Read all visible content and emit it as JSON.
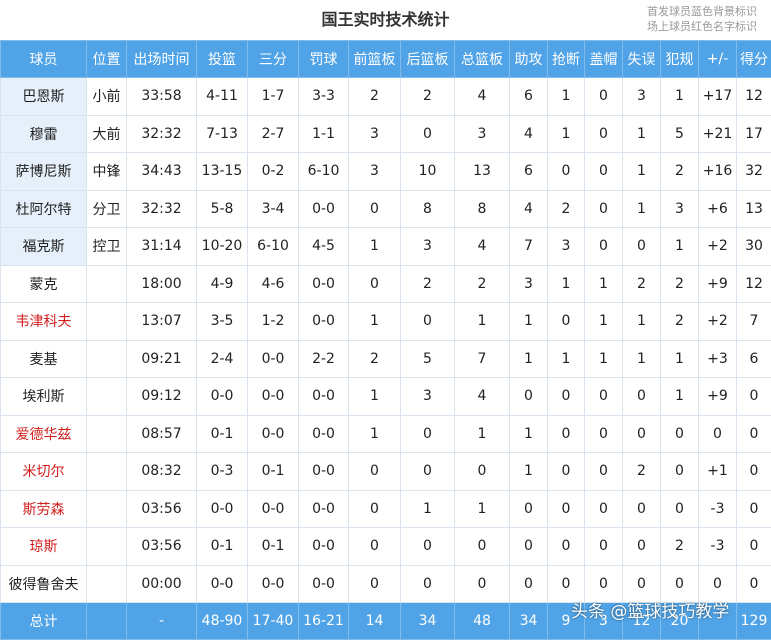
{
  "title": "国王实时技术统计",
  "legend": [
    "首发球员蓝色背景标识",
    "场上球员红色名字标识"
  ],
  "headers": [
    "球员",
    "位置",
    "出场时间",
    "投篮",
    "三分",
    "罚球",
    "前篮板",
    "后篮板",
    "总篮板",
    "助攻",
    "抢断",
    "盖帽",
    "失误",
    "犯规",
    "+/-",
    "得分"
  ],
  "rows": [
    {
      "name": "巴恩斯",
      "pos": "小前",
      "min": "33:58",
      "fg": "4-11",
      "tp": "1-7",
      "ft": "3-3",
      "oreb": "2",
      "dreb": "2",
      "reb": "4",
      "ast": "6",
      "stl": "1",
      "blk": "0",
      "tov": "3",
      "pf": "1",
      "pm": "+17",
      "pts": "12",
      "starter": true,
      "oncourt": false
    },
    {
      "name": "穆雷",
      "pos": "大前",
      "min": "32:32",
      "fg": "7-13",
      "tp": "2-7",
      "ft": "1-1",
      "oreb": "3",
      "dreb": "0",
      "reb": "3",
      "ast": "4",
      "stl": "1",
      "blk": "0",
      "tov": "1",
      "pf": "5",
      "pm": "+21",
      "pts": "17",
      "starter": true,
      "oncourt": false
    },
    {
      "name": "萨博尼斯",
      "pos": "中锋",
      "min": "34:43",
      "fg": "13-15",
      "tp": "0-2",
      "ft": "6-10",
      "oreb": "3",
      "dreb": "10",
      "reb": "13",
      "ast": "6",
      "stl": "0",
      "blk": "0",
      "tov": "1",
      "pf": "2",
      "pm": "+16",
      "pts": "32",
      "starter": true,
      "oncourt": false
    },
    {
      "name": "杜阿尔特",
      "pos": "分卫",
      "min": "32:32",
      "fg": "5-8",
      "tp": "3-4",
      "ft": "0-0",
      "oreb": "0",
      "dreb": "8",
      "reb": "8",
      "ast": "4",
      "stl": "2",
      "blk": "0",
      "tov": "1",
      "pf": "3",
      "pm": "+6",
      "pts": "13",
      "starter": true,
      "oncourt": false
    },
    {
      "name": "福克斯",
      "pos": "控卫",
      "min": "31:14",
      "fg": "10-20",
      "tp": "6-10",
      "ft": "4-5",
      "oreb": "1",
      "dreb": "3",
      "reb": "4",
      "ast": "7",
      "stl": "3",
      "blk": "0",
      "tov": "0",
      "pf": "1",
      "pm": "+2",
      "pts": "30",
      "starter": true,
      "oncourt": false
    },
    {
      "name": "蒙克",
      "pos": "",
      "min": "18:00",
      "fg": "4-9",
      "tp": "4-6",
      "ft": "0-0",
      "oreb": "0",
      "dreb": "2",
      "reb": "2",
      "ast": "3",
      "stl": "1",
      "blk": "1",
      "tov": "2",
      "pf": "2",
      "pm": "+9",
      "pts": "12",
      "starter": false,
      "oncourt": false
    },
    {
      "name": "韦津科夫",
      "pos": "",
      "min": "13:07",
      "fg": "3-5",
      "tp": "1-2",
      "ft": "0-0",
      "oreb": "1",
      "dreb": "0",
      "reb": "1",
      "ast": "1",
      "stl": "0",
      "blk": "1",
      "tov": "1",
      "pf": "2",
      "pm": "+2",
      "pts": "7",
      "starter": false,
      "oncourt": true
    },
    {
      "name": "麦基",
      "pos": "",
      "min": "09:21",
      "fg": "2-4",
      "tp": "0-0",
      "ft": "2-2",
      "oreb": "2",
      "dreb": "5",
      "reb": "7",
      "ast": "1",
      "stl": "1",
      "blk": "1",
      "tov": "1",
      "pf": "1",
      "pm": "+3",
      "pts": "6",
      "starter": false,
      "oncourt": false
    },
    {
      "name": "埃利斯",
      "pos": "",
      "min": "09:12",
      "fg": "0-0",
      "tp": "0-0",
      "ft": "0-0",
      "oreb": "1",
      "dreb": "3",
      "reb": "4",
      "ast": "0",
      "stl": "0",
      "blk": "0",
      "tov": "0",
      "pf": "1",
      "pm": "+9",
      "pts": "0",
      "starter": false,
      "oncourt": false
    },
    {
      "name": "爱德华兹",
      "pos": "",
      "min": "08:57",
      "fg": "0-1",
      "tp": "0-0",
      "ft": "0-0",
      "oreb": "1",
      "dreb": "0",
      "reb": "1",
      "ast": "1",
      "stl": "0",
      "blk": "0",
      "tov": "0",
      "pf": "0",
      "pm": "0",
      "pts": "0",
      "starter": false,
      "oncourt": true
    },
    {
      "name": "米切尔",
      "pos": "",
      "min": "08:32",
      "fg": "0-3",
      "tp": "0-1",
      "ft": "0-0",
      "oreb": "0",
      "dreb": "0",
      "reb": "0",
      "ast": "1",
      "stl": "0",
      "blk": "0",
      "tov": "2",
      "pf": "0",
      "pm": "+1",
      "pts": "0",
      "starter": false,
      "oncourt": true
    },
    {
      "name": "斯劳森",
      "pos": "",
      "min": "03:56",
      "fg": "0-0",
      "tp": "0-0",
      "ft": "0-0",
      "oreb": "0",
      "dreb": "1",
      "reb": "1",
      "ast": "0",
      "stl": "0",
      "blk": "0",
      "tov": "0",
      "pf": "0",
      "pm": "-3",
      "pts": "0",
      "starter": false,
      "oncourt": true
    },
    {
      "name": "琼斯",
      "pos": "",
      "min": "03:56",
      "fg": "0-1",
      "tp": "0-1",
      "ft": "0-0",
      "oreb": "0",
      "dreb": "0",
      "reb": "0",
      "ast": "0",
      "stl": "0",
      "blk": "0",
      "tov": "0",
      "pf": "2",
      "pm": "-3",
      "pts": "0",
      "starter": false,
      "oncourt": true
    },
    {
      "name": "彼得鲁舍夫",
      "pos": "",
      "min": "00:00",
      "fg": "0-0",
      "tp": "0-0",
      "ft": "0-0",
      "oreb": "0",
      "dreb": "0",
      "reb": "0",
      "ast": "0",
      "stl": "0",
      "blk": "0",
      "tov": "0",
      "pf": "0",
      "pm": "0",
      "pts": "0",
      "starter": false,
      "oncourt": false
    }
  ],
  "totals": [
    "总计",
    "",
    "-",
    "48-90",
    "17-40",
    "16-21",
    "14",
    "34",
    "48",
    "34",
    "9",
    "3",
    "12",
    "20",
    "",
    "129"
  ],
  "watermark": "头条 @篮球技巧教学",
  "colors": {
    "header_bg": "#4fa3e6",
    "starter_bg": "#e6f0fa",
    "oncourt_text": "#d21e1e"
  }
}
